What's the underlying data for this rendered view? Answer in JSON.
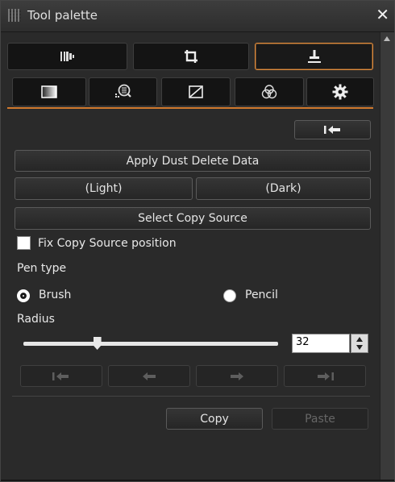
{
  "window": {
    "title": "Tool palette",
    "close_label": "✕"
  },
  "undo_label": "⤒",
  "buttons": {
    "apply_dust": "Apply Dust Delete Data",
    "light": "(Light)",
    "dark": "(Dark)",
    "select_copy_source": "Select Copy Source",
    "copy": "Copy",
    "paste": "Paste"
  },
  "labels": {
    "fix_copy_source": "Fix Copy Source position",
    "pen_type": "Pen type",
    "brush": "Brush",
    "pencil": "Pencil",
    "radius": "Radius"
  },
  "radius": {
    "value": "32",
    "slider_fraction": 0.29
  },
  "pen_type_selected": "Brush",
  "fix_copy_source_checked": false,
  "colors": {
    "accent": "#e08a3a",
    "background": "#2a2a2a"
  },
  "top_tabs": [
    {
      "icon": "histogram-bars-icon",
      "active": false
    },
    {
      "icon": "crop-icon",
      "active": false
    },
    {
      "icon": "stamp-icon",
      "active": true
    }
  ],
  "sub_tabs": [
    {
      "icon": "gradient-square-icon",
      "active": true
    },
    {
      "icon": "magnifier-grid-icon",
      "active": false
    },
    {
      "icon": "tone-curve-icon",
      "active": false
    },
    {
      "icon": "rgb-circles-icon",
      "active": false
    },
    {
      "icon": "gear-icon",
      "active": false
    }
  ],
  "history_buttons": [
    {
      "icon": "undo-to-start-icon",
      "enabled": false
    },
    {
      "icon": "undo-icon",
      "enabled": false
    },
    {
      "icon": "redo-icon",
      "enabled": false
    },
    {
      "icon": "redo-to-end-icon",
      "enabled": false
    }
  ]
}
